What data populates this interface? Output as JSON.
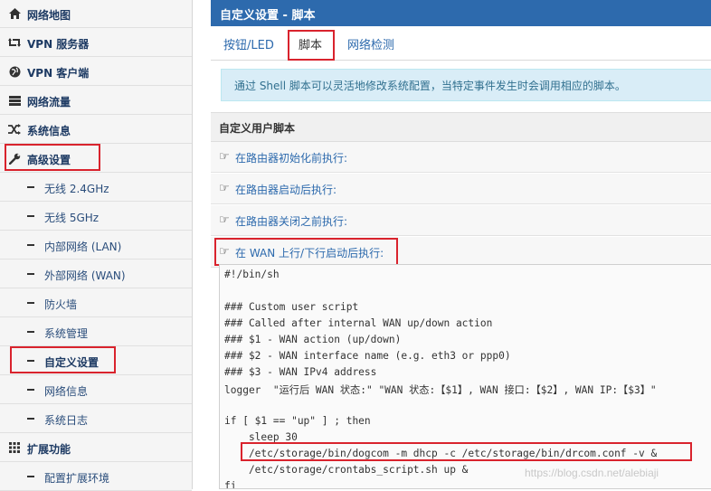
{
  "sidebar": {
    "items": [
      {
        "label": "网络地图",
        "icon": "home-icon"
      },
      {
        "label": "VPN 服务器",
        "icon": "retweet-icon"
      },
      {
        "label": "VPN 客户端",
        "icon": "globe-icon"
      },
      {
        "label": "网络流量",
        "icon": "hdd-icon"
      },
      {
        "label": "系统信息",
        "icon": "random-icon"
      },
      {
        "label": "高级设置",
        "icon": "wrench-icon"
      },
      {
        "label": "无线 2.4GHz"
      },
      {
        "label": "无线 5GHz"
      },
      {
        "label": "内部网络 (LAN)"
      },
      {
        "label": "外部网络 (WAN)"
      },
      {
        "label": "防火墙"
      },
      {
        "label": "系统管理"
      },
      {
        "label": "自定义设置"
      },
      {
        "label": "网络信息"
      },
      {
        "label": "系统日志"
      },
      {
        "label": "扩展功能",
        "icon": "grid-icon"
      },
      {
        "label": "配置扩展环境"
      }
    ]
  },
  "page": {
    "title": "自定义设置 - 脚本",
    "tabs": [
      "按钮/LED",
      "脚本",
      "网络检测"
    ],
    "info": "通过 Shell 脚本可以灵活地修改系统配置，当特定事件发生时会调用相应的脚本。",
    "section_title": "自定义用户脚本",
    "scripts": [
      "在路由器初始化前执行:",
      "在路由器启动后执行:",
      "在路由器关闭之前执行:",
      "在 WAN 上行/下行启动后执行:"
    ]
  },
  "code_lines": [
    "#!/bin/sh",
    "",
    "### Custom user script",
    "### Called after internal WAN up/down action",
    "### $1 - WAN action (up/down)",
    "### $2 - WAN interface name (e.g. eth3 or ppp0)",
    "### $3 - WAN IPv4 address",
    "logger  \"运行后 WAN 状态:\" \"WAN 状态:【$1】, WAN 接口:【$2】, WAN IP:【$3】\"",
    "",
    "if [ $1 == \"up\" ] ; then",
    "    sleep 30",
    "    /etc/storage/bin/dogcom -m dhcp -c /etc/storage/bin/drcom.conf -v &",
    "    /etc/storage/crontabs_script.sh up &",
    "fi"
  ],
  "watermark": "https://blog.csdn.net/alebiaji",
  "colors": {
    "accent": "#2d6aad",
    "highlight": "#d9232d"
  }
}
